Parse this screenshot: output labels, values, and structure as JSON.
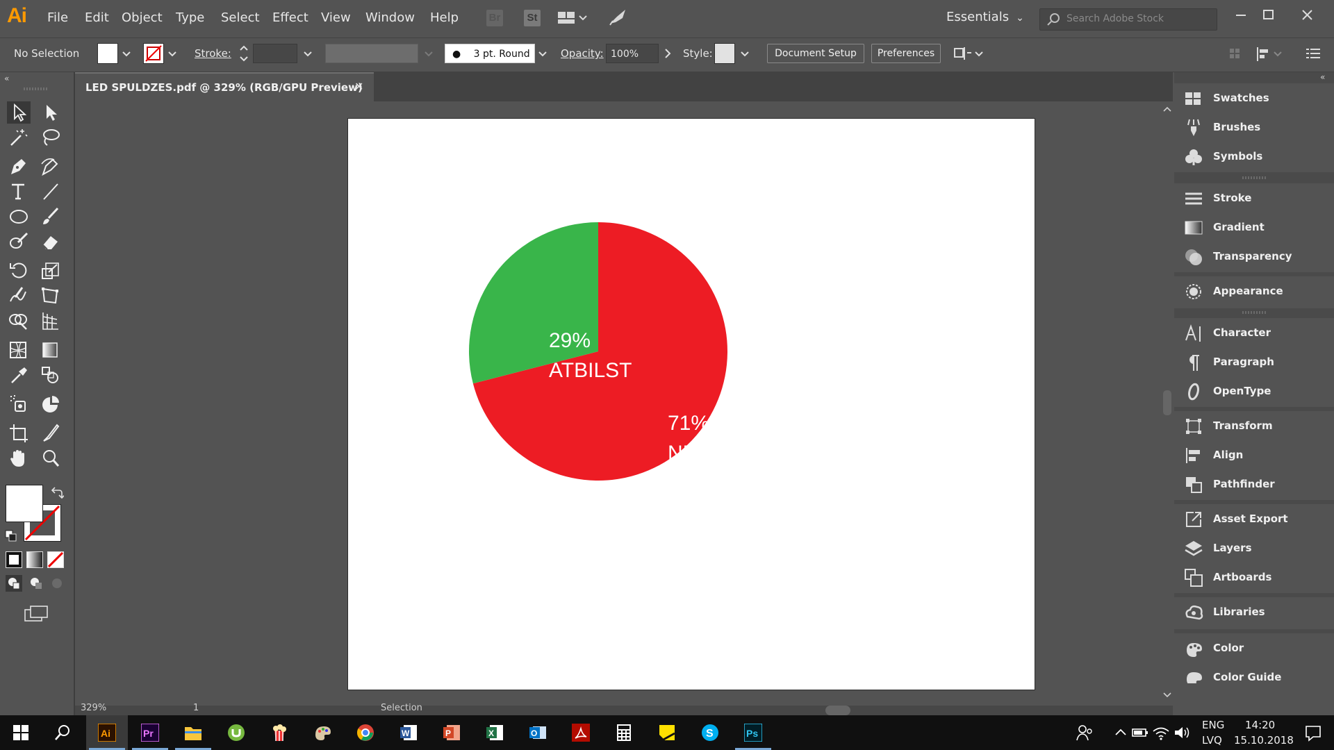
{
  "app": {
    "logo": "Ai",
    "workspace": "Essentials",
    "search_placeholder": "Search Adobe Stock",
    "bridge": "Br",
    "stock": "St"
  },
  "menu": [
    "File",
    "Edit",
    "Object",
    "Type",
    "Select",
    "Effect",
    "View",
    "Window",
    "Help"
  ],
  "control": {
    "selection": "No Selection",
    "stroke_label": "Stroke:",
    "brush": "3 pt. Round",
    "opacity_label": "Opacity:",
    "opacity_value": "100%",
    "style_label": "Style:",
    "document_setup": "Document Setup",
    "preferences": "Preferences"
  },
  "document": {
    "tab_title": "LED SPULDZES.pdf @ 329% (RGB/GPU Preview)",
    "close": "✕"
  },
  "tools": [
    "selection-tool",
    "direct-selection-tool",
    "magic-wand-tool",
    "lasso-tool",
    "pen-tool",
    "curvature-tool",
    "type-tool",
    "line-tool",
    "ellipse-tool",
    "paintbrush-tool",
    "shaper-tool",
    "eraser-tool",
    "rotate-tool",
    "scale-tool",
    "warp-tool",
    "free-transform-tool",
    "shape-builder-tool",
    "perspective-grid-tool",
    "mesh-tool",
    "gradient-tool",
    "eyedropper-tool",
    "blend-tool",
    "symbol-sprayer-tool",
    "column-graph-tool",
    "artboard-tool",
    "slice-tool",
    "hand-tool",
    "zoom-tool"
  ],
  "chart_data": {
    "type": "pie",
    "colors": {
      "neatbilst": "#ed1c24",
      "atbilst": "#39b54a"
    },
    "slices": [
      {
        "label_value": "71%",
        "label_text": "NEATBILST",
        "value": 71,
        "color": "#ed1c24"
      },
      {
        "label_value": "29%",
        "label_text": "ATBILST",
        "value": 29,
        "color": "#39b54a"
      }
    ]
  },
  "panels": [
    {
      "label": "Swatches",
      "icon": "swatches-icon"
    },
    {
      "label": "Brushes",
      "icon": "brushes-icon"
    },
    {
      "label": "Symbols",
      "icon": "symbols-icon"
    },
    {
      "label": "Stroke",
      "icon": "stroke-icon"
    },
    {
      "label": "Gradient",
      "icon": "gradient-icon"
    },
    {
      "label": "Transparency",
      "icon": "transparency-icon"
    },
    {
      "label": "Appearance",
      "icon": "appearance-icon"
    },
    {
      "label": "Character",
      "icon": "character-icon"
    },
    {
      "label": "Paragraph",
      "icon": "paragraph-icon"
    },
    {
      "label": "OpenType",
      "icon": "opentype-icon"
    },
    {
      "label": "Transform",
      "icon": "transform-icon"
    },
    {
      "label": "Align",
      "icon": "align-icon"
    },
    {
      "label": "Pathfinder",
      "icon": "pathfinder-icon"
    },
    {
      "label": "Asset Export",
      "icon": "asset-export-icon"
    },
    {
      "label": "Layers",
      "icon": "layers-icon"
    },
    {
      "label": "Artboards",
      "icon": "artboards-icon"
    },
    {
      "label": "Libraries",
      "icon": "libraries-icon"
    },
    {
      "label": "Color",
      "icon": "color-icon"
    },
    {
      "label": "Color Guide",
      "icon": "color-guide-icon"
    }
  ],
  "status": {
    "zoom": "329%",
    "page": "1",
    "mode": "Selection"
  },
  "taskbar": {
    "apps": [
      "start",
      "search",
      "illustrator",
      "premiere",
      "file-explorer",
      "utorrent",
      "popcorn",
      "paint",
      "chrome",
      "word",
      "powerpoint",
      "excel",
      "outlook",
      "acrobat",
      "calculator",
      "sticky-notes",
      "skype",
      "photoshop"
    ],
    "lang_1": "ENG",
    "lang_2": "LVQ",
    "time": "14:20",
    "date": "15.10.2018"
  }
}
